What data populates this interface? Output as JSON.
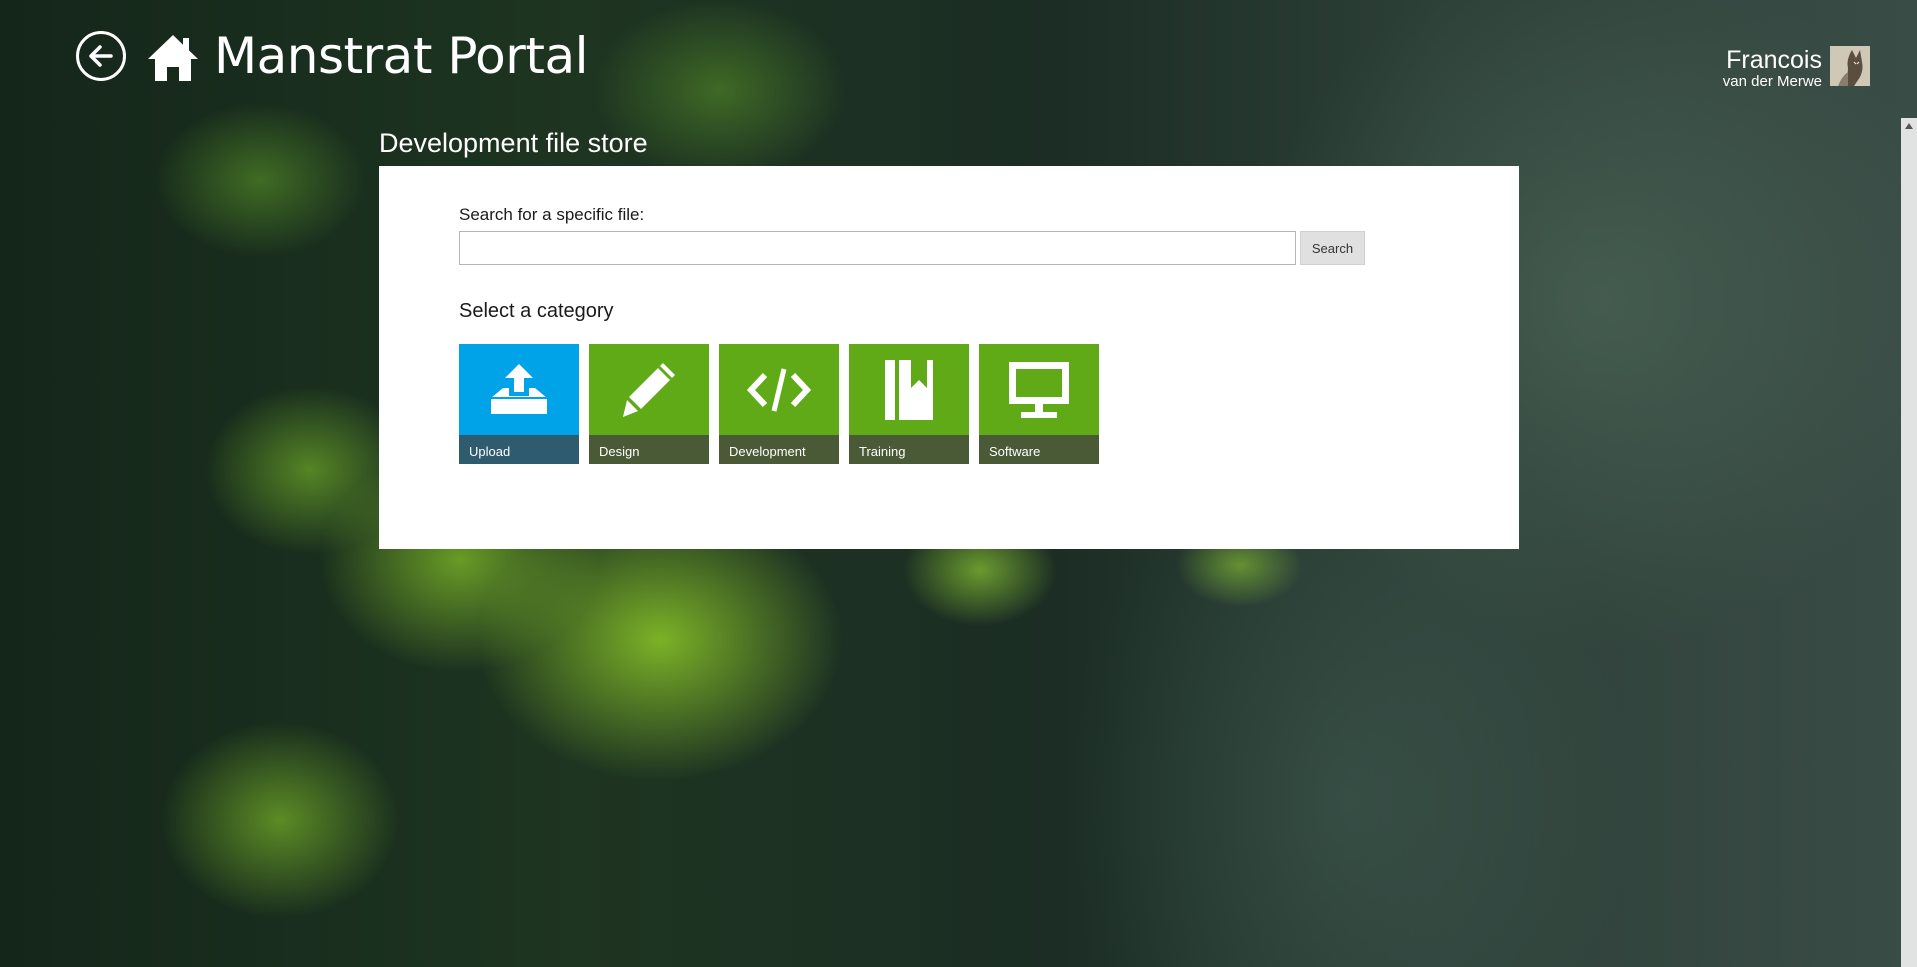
{
  "header": {
    "app_title": "Manstrat Portal",
    "back_icon": "arrow-left-circle-icon",
    "home_icon": "home-icon"
  },
  "user": {
    "first_name": "Francois",
    "last_name": "van der Merwe",
    "avatar_icon": "user-avatar"
  },
  "section": {
    "title": "Development file store"
  },
  "search": {
    "label": "Search for a specific file:",
    "value": "",
    "placeholder": "",
    "button_label": "Search"
  },
  "categories": {
    "heading": "Select a category",
    "tiles": [
      {
        "label": "Upload",
        "icon": "upload-icon",
        "color": "#00a2e8",
        "label_bg": "#2e5b6e"
      },
      {
        "label": "Design",
        "icon": "pencil-icon",
        "color": "#60a917",
        "label_bg": "#4a5a36"
      },
      {
        "label": "Development",
        "icon": "code-icon",
        "color": "#60a917",
        "label_bg": "#4a5a36"
      },
      {
        "label": "Training",
        "icon": "book-icon",
        "color": "#60a917",
        "label_bg": "#4a5a36"
      },
      {
        "label": "Software",
        "icon": "monitor-icon",
        "color": "#60a917",
        "label_bg": "#4a5a36"
      }
    ]
  }
}
